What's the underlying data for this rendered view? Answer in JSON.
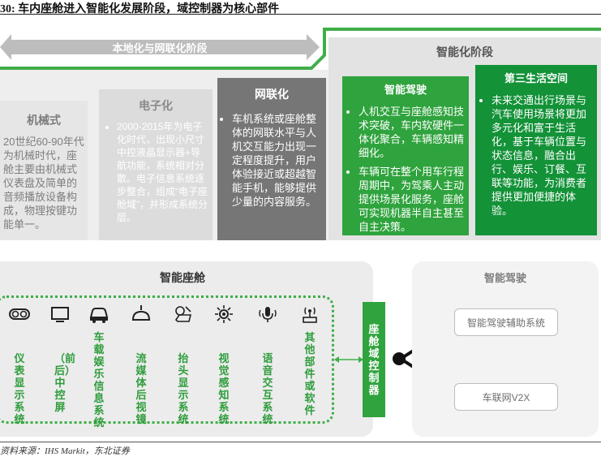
{
  "figure_title": "30:  车内座舱进入智能化发展阶段，域控制器为核心部件",
  "top": {
    "arrow_label": "本地化与网联化阶段",
    "smart_stage_label": "智能化阶段",
    "mechanical": {
      "title": "机械式",
      "text": "20世纪60-90年代为机械时代，座舱主要由机械式仪表盘及简单的音频播放设备构成，物理按键功能单一。"
    },
    "electronic": {
      "title": "电子化",
      "text": "2000-2015年为电子化时代，出现小尺寸中控液晶显示器+导航功能，系统相对分散。电子信息系统逐步整合，组成“电子座舱域”，并形成系统分层。"
    },
    "connected": {
      "title": "网联化",
      "text": "车机系统或座舱整体的网联水平与人机交互能力出现一定程度提升，用户体验接近或超越智能手机，能够提供少量的内容服务。"
    },
    "smart_driving": {
      "title": "智能驾驶",
      "bullets": [
        "人机交互与座舱感知技术突破，车内软硬件一体化聚合，车辆感知精细化。",
        "车辆可在整个用车行程周期中，为驾乘人主动提供场景化服务，座舱可实现机器半自主甚至自主决策。"
      ]
    },
    "third_space": {
      "title": "第三生活空间",
      "bullets": [
        "未来交通出行场景与汽车使用场景将更加多元化和富于生活化，基于车辆位置与状态信息，融合出行、娱乐、订餐、互联等功能，为消费者提供更加便捷的体验。"
      ]
    }
  },
  "bottom": {
    "cockpit_label": "智能座舱",
    "components": [
      {
        "icon": "gauge-icon",
        "label": "仪表显示系统"
      },
      {
        "icon": "monitor-icon",
        "label": "（前后）中控屏"
      },
      {
        "icon": "car-icon",
        "label": "车载娱乐信息系统"
      },
      {
        "icon": "mirror-icon",
        "label": "流媒体后视镜"
      },
      {
        "icon": "hud-icon",
        "label": "抬头显示系统"
      },
      {
        "icon": "eye-sensor-icon",
        "label": "视觉感知系统"
      },
      {
        "icon": "microphone-icon",
        "label": "语音交互系统"
      },
      {
        "icon": "wireless-icon",
        "label": "其他部件或软件"
      }
    ],
    "controller_label": "座舱域控制器",
    "driving_panel": {
      "title": "智能驾驶",
      "items": [
        "智能驾驶辅助系统",
        "车联网V2X"
      ]
    }
  },
  "source": "资料来源：IHS Markit，东北证券"
}
